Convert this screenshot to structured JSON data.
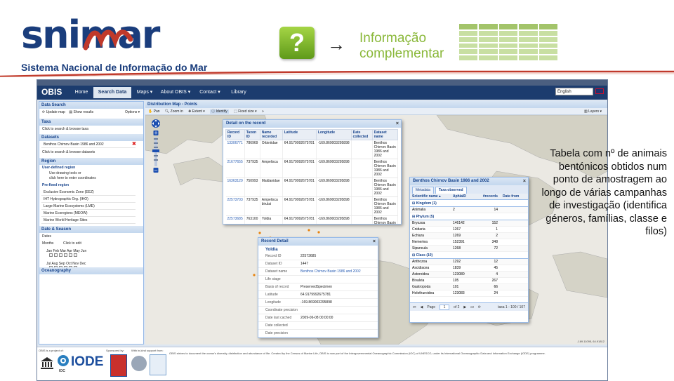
{
  "brand": {
    "word": "snimar",
    "subtitle": "Sistema Nacional de Informação do Mar"
  },
  "header": {
    "question_mark": "?",
    "arrow": "→",
    "info_line1": "Informação",
    "info_line2": "complementar"
  },
  "colors": {
    "brand_blue": "#1a3d7c",
    "accent_green": "#8ab83a",
    "obis_nav": "#1c3c6e"
  },
  "obis": {
    "logo": "OBIS",
    "nav": [
      "Home",
      "Search Data",
      "Maps ▾",
      "About OBIS ▾",
      "Contact ▾",
      "Library"
    ],
    "language": "English"
  },
  "left_panel": {
    "title": "Data Search",
    "update_map": "Update map",
    "show_results": "Show results",
    "options": "Options ▾",
    "taxa_header": "Taxa",
    "taxa_hint": "Click to search & browse taxa",
    "datasets_header": "Datasets",
    "dataset_selected": "Benthos Chirnov Basin 1986 and 2002",
    "dataset_hint": "Click to search & browse datasets",
    "region_header": "Region",
    "user_region": "User-defined region",
    "drawing_hint1": "Use drawing tools or",
    "drawing_hint2": "click here to enter coordinates",
    "prefixed": "Pre-fixed region",
    "regions": [
      "Exclusive Economic Zone (EEZ)",
      "IHT Hydrographic Org. (IHO)",
      "Large Marine Ecosystems (LME)",
      "Marine Ecoregions (MEOW)",
      "Marine World Heritage Sites"
    ],
    "date_header": "Date & Season",
    "dates_label": "Dates",
    "months_label": "Months",
    "click_edit": "Click to edit",
    "months_row1": "Jan Feb Mar Apr May Jun",
    "months_row2": "Jul Aug Sep Oct Nov Dec",
    "oceanography_header": "Oceanography"
  },
  "map": {
    "title": "Distribution Map - Points",
    "toolbar": [
      "Pan",
      "Zoom in",
      "Extent ▾",
      "Identify",
      "Fixed size ▾",
      "»"
    ],
    "layers": "Layers ▾",
    "coords": "-169.11095, 64.91812"
  },
  "detail_record": {
    "title": "Detail on the record",
    "columns": [
      "Record ID",
      "Taxon ID",
      "Name recorded",
      "Latitude",
      "Longitude",
      "Date collected",
      "Dataset name"
    ],
    "rows": [
      [
        "13306771",
        "786969",
        "Orbiniidae",
        "64.9179992675781",
        "-169.869003295898",
        "",
        "Benthos Chirnov Basin 1986 and 2002"
      ],
      [
        "21677655",
        "737935",
        "Ampelisca",
        "64.9179992675781",
        "-169.869003295898",
        "",
        "Benthos Chirnov Basin 1986 and 2002"
      ],
      [
        "16363129",
        "750993",
        "Maldanidae",
        "64.9179992675781",
        "-169.869003295898",
        "",
        "Benthos Chirnov Basin 1986 and 2002"
      ],
      [
        "22573703",
        "737935",
        "Ampelisca birulai",
        "64.9179992675781",
        "-169.869003295898",
        "",
        "Benthos Chirnov Basin 1986 and 2002"
      ],
      [
        "22573685",
        "763100",
        "Yoldia",
        "64.9179992675781",
        "-169.869003295898",
        "",
        "Benthos Chirnov Basin 1986 and 2002"
      ]
    ]
  },
  "record_detail": {
    "title": "Record Detail",
    "name": "Yoldia",
    "fields": [
      [
        "Record ID",
        "22573685"
      ],
      [
        "Dataset ID",
        "1447"
      ],
      [
        "Dataset name",
        "Benthos Chirnov Basin 1986 and 2002"
      ],
      [
        "Life stage",
        ""
      ],
      [
        "Basis of record",
        "PreservedSpecimen"
      ],
      [
        "Latitude",
        "64.9179992675781"
      ],
      [
        "Longitude",
        "-169.869003295898"
      ],
      [
        "Coordinate precision",
        ""
      ],
      [
        "Date last cached",
        "2009-06-08 00:00:00"
      ],
      [
        "Date collected",
        ""
      ],
      [
        "Date precision",
        ""
      ],
      [
        "Date last modified",
        "2009-06-22T00:12:41Z"
      ]
    ]
  },
  "taxa_window": {
    "title": "Benthos Chirnov Basin 1986 and 2002",
    "tabs": [
      "Metadata",
      "Taxa observed"
    ],
    "columns": [
      "Scientific name",
      "AphiaID",
      "#records",
      "Date from"
    ],
    "groups": [
      {
        "label": "Kingdom (1)",
        "rows": [
          [
            "Animalia",
            "2",
            "14"
          ]
        ]
      },
      {
        "label": "Phylum (5)",
        "rows": [
          [
            "Bryozoa",
            "146142",
            "152"
          ],
          [
            "Cnidaria",
            "1267",
            "1"
          ],
          [
            "Echiura",
            "1269",
            "2"
          ],
          [
            "Nemertea",
            "152391",
            "348"
          ],
          [
            "Sipuncula",
            "1268",
            "72"
          ]
        ]
      },
      {
        "label": "Class (10)",
        "rows": [
          [
            "Anthozoa",
            "1292",
            "12"
          ],
          [
            "Ascidiacea",
            "1839",
            "45"
          ],
          [
            "Asteroidea",
            "123080",
            "4"
          ],
          [
            "Bivalvia",
            "105",
            "267"
          ],
          [
            "Gastropoda",
            "101",
            "66"
          ],
          [
            "Holothuroidea",
            "123083",
            "24"
          ]
        ]
      }
    ],
    "pager_page": "Page",
    "pager_of": "of 2",
    "pager_value": "1",
    "pager_summary": "taxa 1 - 100 / 107"
  },
  "footer": {
    "project": "OBIS is a project of:",
    "sponsored": "Sponsored by:",
    "hosting": "With in-kind support from:",
    "iode": "IODE",
    "ioc": "IOC",
    "credit": "OBIS strives to document the ocean's diversity, distribution and abundance of life. Created by the Census of Marine Life, OBIS is now part of the Intergovernmental Oceanographic Commission (IOC) of UNESCO, under its International Oceanographic Data and Information Exchange (IODE) programme."
  },
  "description": "Tabela com nº de animais bentónicos obtidos num ponto de amostragem ao longo de várias campanhas de investigação (identifica géneros, famílias, classe e filos)"
}
